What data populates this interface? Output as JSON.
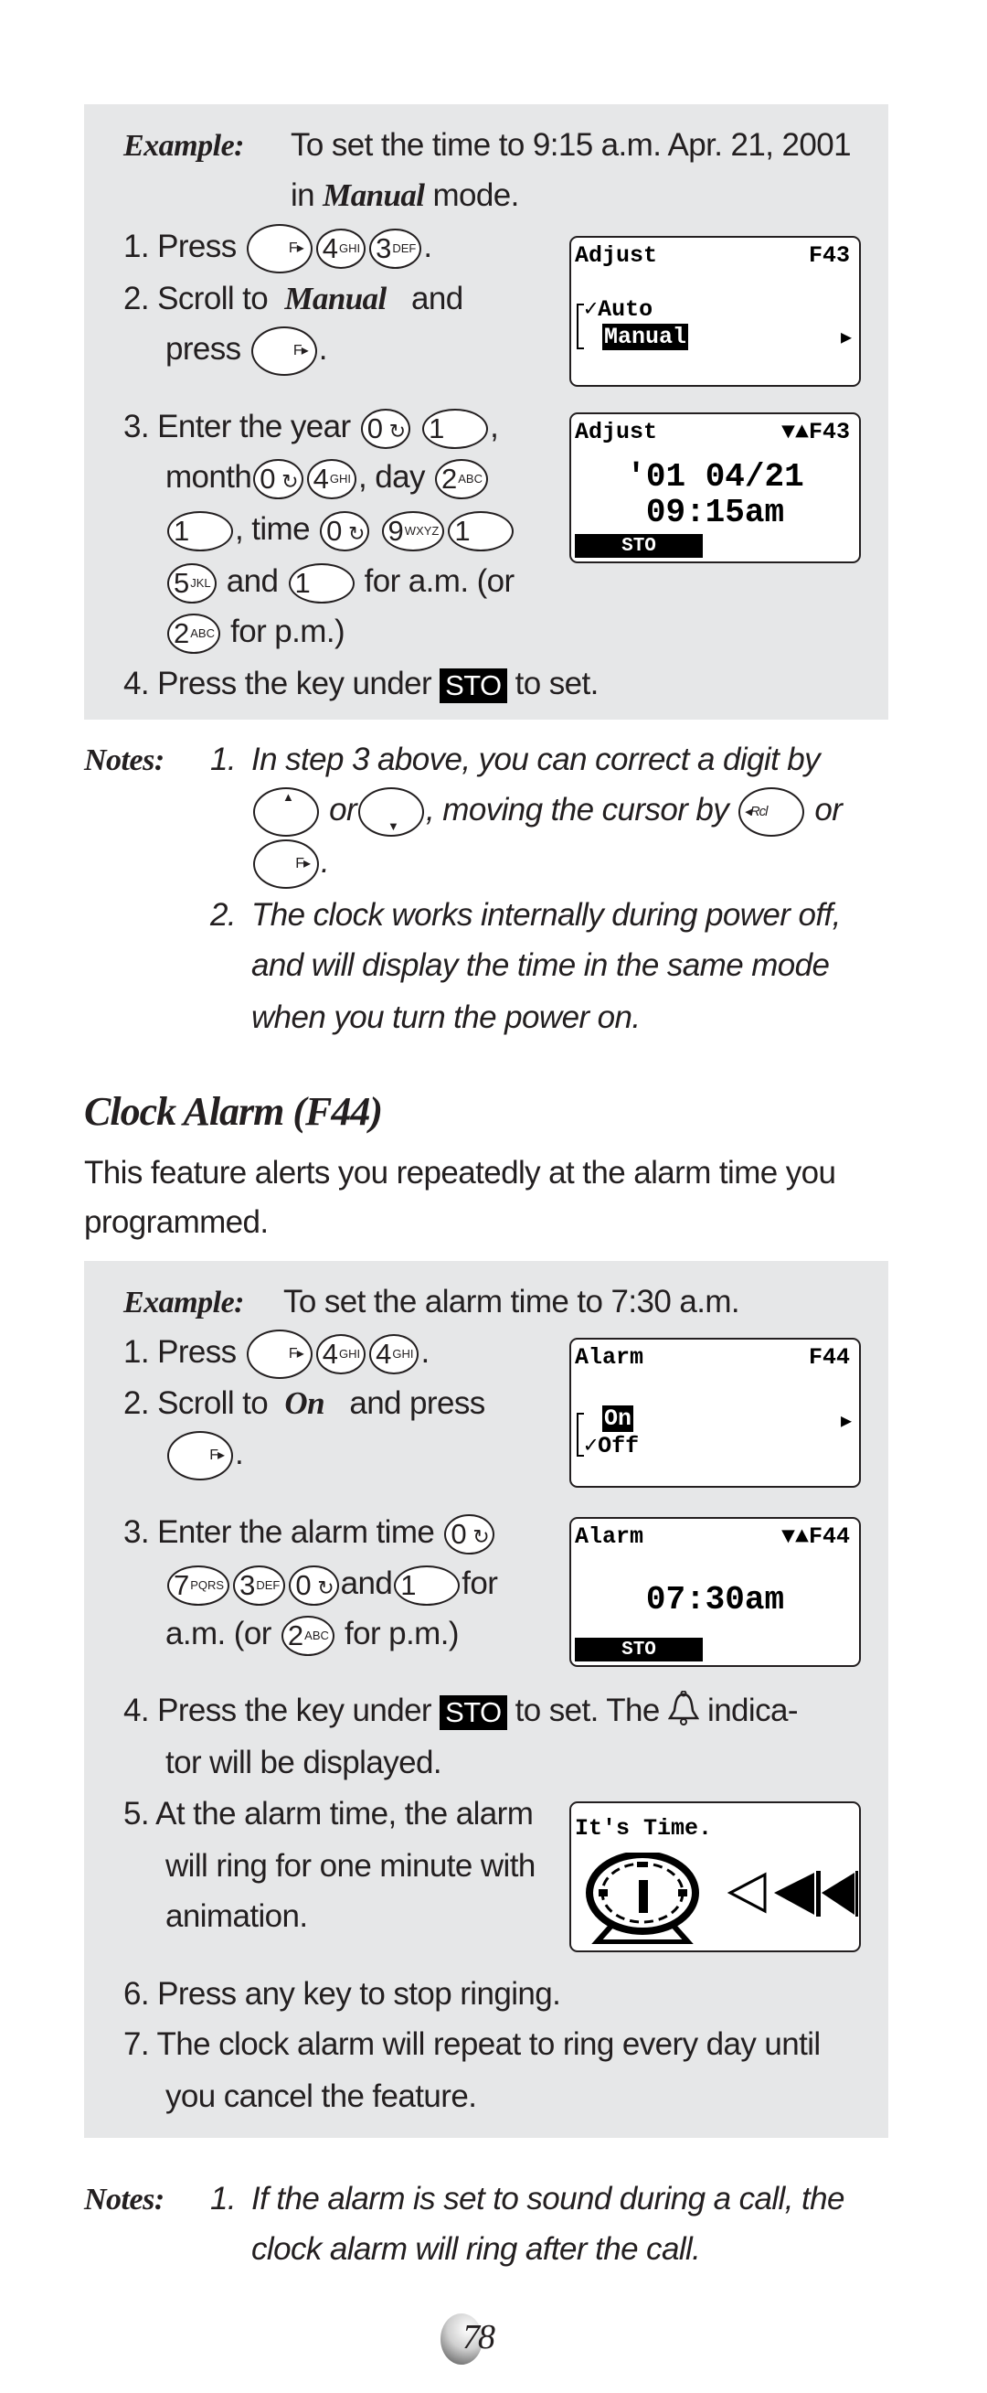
{
  "section1": {
    "example_label": "Example:",
    "example_text_1": "To set the time to 9:15 a.m. Apr. 21, 2001",
    "example_text_2a": "in",
    "example_text_2b": "Manual",
    "example_text_2c": "mode.",
    "steps": {
      "s1_num": "1.",
      "s1_text": "Press",
      "s2_num": "2.",
      "s2_a": "Scroll  to",
      "s2_b": "Manual",
      "s2_c": "and",
      "s2_d": "press",
      "s3_num": "3.",
      "s3_a": "Enter the year",
      "s3_b": "month",
      "s3_c": ", day",
      "s3_d": ", time",
      "s3_e": "and",
      "s3_f": "for a.m. (or",
      "s3_g": "for p.m.)",
      "s4_num": "4.",
      "s4_a": "Press the key under",
      "s4_b": "to set."
    },
    "lcd1": {
      "title": "Adjust",
      "code": "F43",
      "options": [
        "Auto",
        "Manual"
      ],
      "checked": "Auto",
      "selected": "Manual"
    },
    "lcd2": {
      "title": "Adjust",
      "code": "▼▲F43",
      "date": "'01 04/21",
      "time": "09:15am",
      "softkey": "STO"
    }
  },
  "notes1": {
    "label": "Notes:",
    "n1_num": "1.",
    "n1_a": "In step 3 above, you can correct a digit by",
    "n1_b": "or",
    "n1_c": ", moving the cursor by",
    "n1_d": "or",
    "n2_num": "2.",
    "n2_lines": [
      "The clock works internally during power off,",
      "and will display the time in the same mode",
      "when you turn the power on."
    ]
  },
  "section2": {
    "heading": "Clock Alarm (F44)",
    "intro": [
      "This feature alerts you repeatedly at the alarm time you",
      "programmed."
    ],
    "example_label": "Example:",
    "example_text": "To set the alarm time to 7:30 a.m.",
    "steps": {
      "s1_text": "1. Press",
      "s2_a": "2. Scroll  to",
      "s2_b": "On",
      "s2_c": "and  press",
      "s3_a": "3. Enter the alarm time",
      "s3_b": "and",
      "s3_c": "for",
      "s3_d": "a.m. (or",
      "s3_e": "for p.m.)",
      "s4_a": "4. Press the key under",
      "s4_b": "to set. The",
      "s4_c": "indica-",
      "s4_d": "tor will be displayed.",
      "s5": [
        "5. At the alarm time, the alarm",
        "will ring for one minute with",
        "animation."
      ],
      "s6": "6. Press any key to stop ringing.",
      "s7": [
        "7. The clock alarm will repeat to ring every day until",
        "you cancel the feature."
      ]
    },
    "lcd3": {
      "title": "Alarm",
      "code": "F44",
      "options": [
        "On",
        "Off"
      ],
      "selected": "On",
      "checked": "Off"
    },
    "lcd4": {
      "title": "Alarm",
      "code": "▼▲F44",
      "time": "07:30am",
      "softkey": "STO"
    },
    "lcd5": {
      "title": "It's Time."
    }
  },
  "notes2": {
    "label": "Notes:",
    "n1_num": "1.",
    "lines": [
      "If the alarm is set to sound during a call, the",
      "clock alarm will ring after the call."
    ]
  },
  "keys": {
    "f": "F",
    "k0": "0",
    "k0_sym": "↻",
    "k1": "1",
    "k2": "2",
    "k2_sub": "ABC",
    "k3": "3",
    "k3_sub": "DEF",
    "k4": "4",
    "k4_sub": "GHI",
    "k5": "5",
    "k5_sub": "JKL",
    "k7": "7",
    "k7_sub": "PQRS",
    "k9": "9",
    "k9_sub": "WXYZ",
    "rcl": "Rcl",
    "sto": "STO"
  },
  "page_number": "78"
}
